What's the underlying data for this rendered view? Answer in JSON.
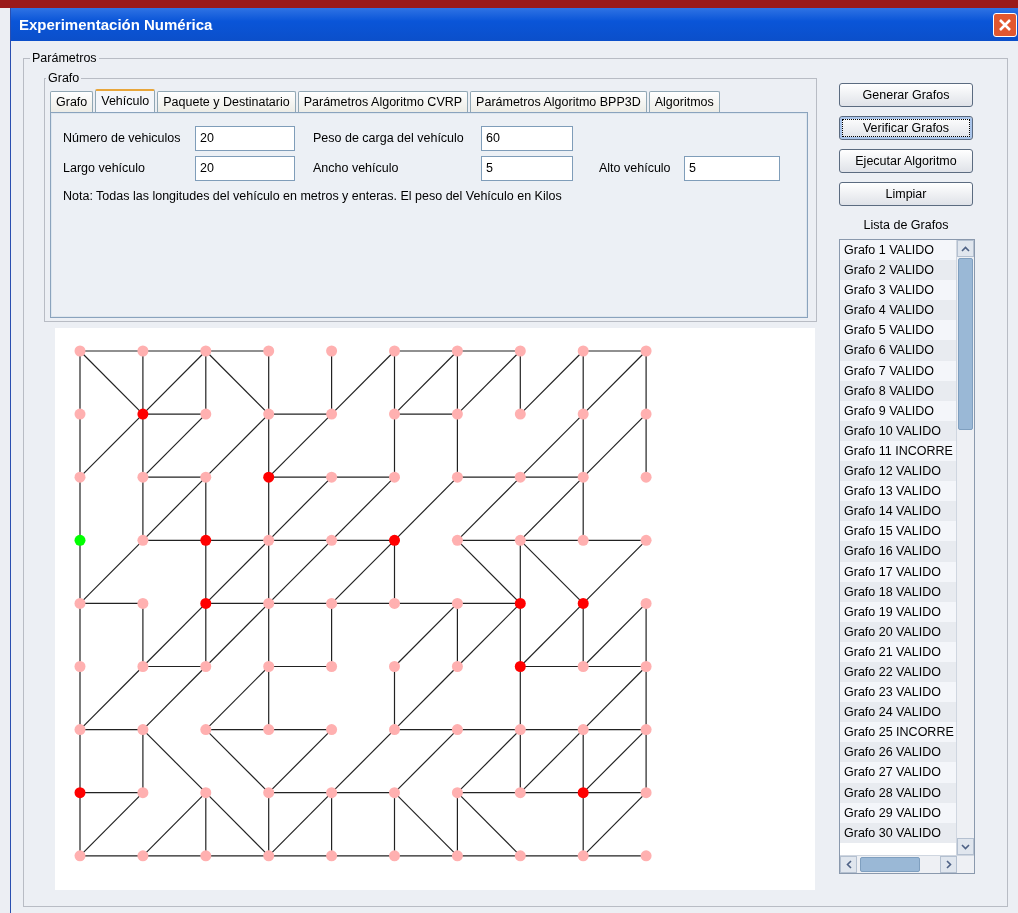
{
  "window": {
    "title": "Experimentación Numérica"
  },
  "parameters": {
    "legend": "Parámetros"
  },
  "graph_group": {
    "legend": "Grafo"
  },
  "tabs": [
    {
      "label": "Grafo",
      "selected": false
    },
    {
      "label": "Vehículo",
      "selected": true
    },
    {
      "label": "Paquete y Destinatario",
      "selected": false
    },
    {
      "label": "Parámetros Algoritmo CVRP",
      "selected": false
    },
    {
      "label": "Parámetros Algoritmo BPP3D",
      "selected": false
    },
    {
      "label": "Algoritmos",
      "selected": false
    }
  ],
  "fields": [
    [
      {
        "label": "Número de vehiculos",
        "value": "20"
      },
      {
        "label": "Peso de carga del vehículo",
        "value": "60"
      }
    ],
    [
      {
        "label": "Largo vehículo",
        "value": "20"
      },
      {
        "label": "Ancho vehículo",
        "value": "5"
      },
      {
        "label": "Alto vehículo",
        "value": "5"
      }
    ]
  ],
  "note": "Nota: Todas las longitudes del vehículo en metros y enteras. El peso del Vehículo en Kilos",
  "buttons": [
    {
      "label": "Generar Grafos",
      "focused": false
    },
    {
      "label": "Verificar Grafos",
      "focused": true
    },
    {
      "label": "Ejecutar Algoritmo",
      "focused": false
    },
    {
      "label": "Limpiar",
      "focused": false
    }
  ],
  "graph_list": {
    "title": "Lista de Grafos",
    "items": [
      "Grafo 1 VALIDO",
      "Grafo 2 VALIDO",
      "Grafo 3 VALIDO",
      "Grafo 4 VALIDO",
      "Grafo 5 VALIDO",
      "Grafo 6 VALIDO",
      "Grafo 7 VALIDO",
      "Grafo 8 VALIDO",
      "Grafo 9 VALIDO",
      "Grafo 10 VALIDO",
      "Grafo 11 INCORRE",
      "Grafo 12 VALIDO",
      "Grafo 13 VALIDO",
      "Grafo 14 VALIDO",
      "Grafo 15 VALIDO",
      "Grafo 16 VALIDO",
      "Grafo 17 VALIDO",
      "Grafo 18 VALIDO",
      "Grafo 19 VALIDO",
      "Grafo 20 VALIDO",
      "Grafo 21 VALIDO",
      "Grafo 22 VALIDO",
      "Grafo 23 VALIDO",
      "Grafo 24 VALIDO",
      "Grafo 25 INCORRE",
      "Grafo 26 VALIDO",
      "Grafo 27 VALIDO",
      "Grafo 28 VALIDO",
      "Grafo 29 VALIDO",
      "Grafo 30 VALIDO"
    ]
  }
}
